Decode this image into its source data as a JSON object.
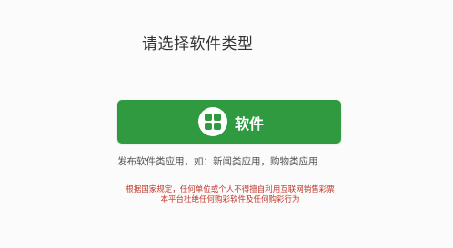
{
  "page": {
    "title": "请选择软件类型"
  },
  "software_button": {
    "icon": "app-grid-icon",
    "label": "软件",
    "color": "#2f9a40"
  },
  "description": "发布软件类应用，如：新闻类应用，购物类应用",
  "notice": {
    "line1": "根据国家规定，任何单位或个人不得擅自利用互联网销售彩票",
    "line2": "本平台杜绝任何购彩软件及任何购彩行为",
    "color": "#c0392b"
  }
}
